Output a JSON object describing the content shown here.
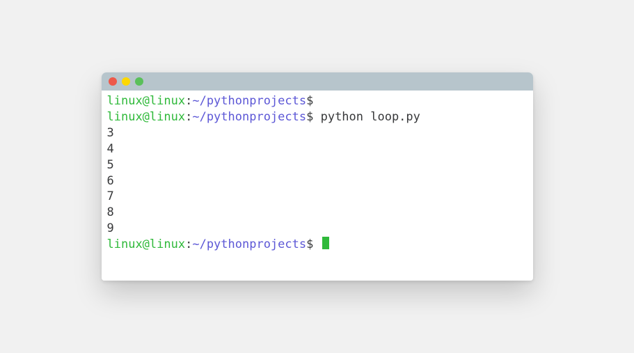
{
  "prompt": {
    "user": "linux@linux",
    "sep1": ":",
    "path": "~/pythonprojects",
    "sep2": "$"
  },
  "lines": [
    {
      "type": "prompt",
      "command": ""
    },
    {
      "type": "prompt",
      "command": "python loop.py"
    },
    {
      "type": "output",
      "text": "3"
    },
    {
      "type": "output",
      "text": "4"
    },
    {
      "type": "output",
      "text": "5"
    },
    {
      "type": "output",
      "text": "6"
    },
    {
      "type": "output",
      "text": "7"
    },
    {
      "type": "output",
      "text": "8"
    },
    {
      "type": "output",
      "text": "9"
    },
    {
      "type": "prompt",
      "command": "",
      "cursor": true
    }
  ]
}
